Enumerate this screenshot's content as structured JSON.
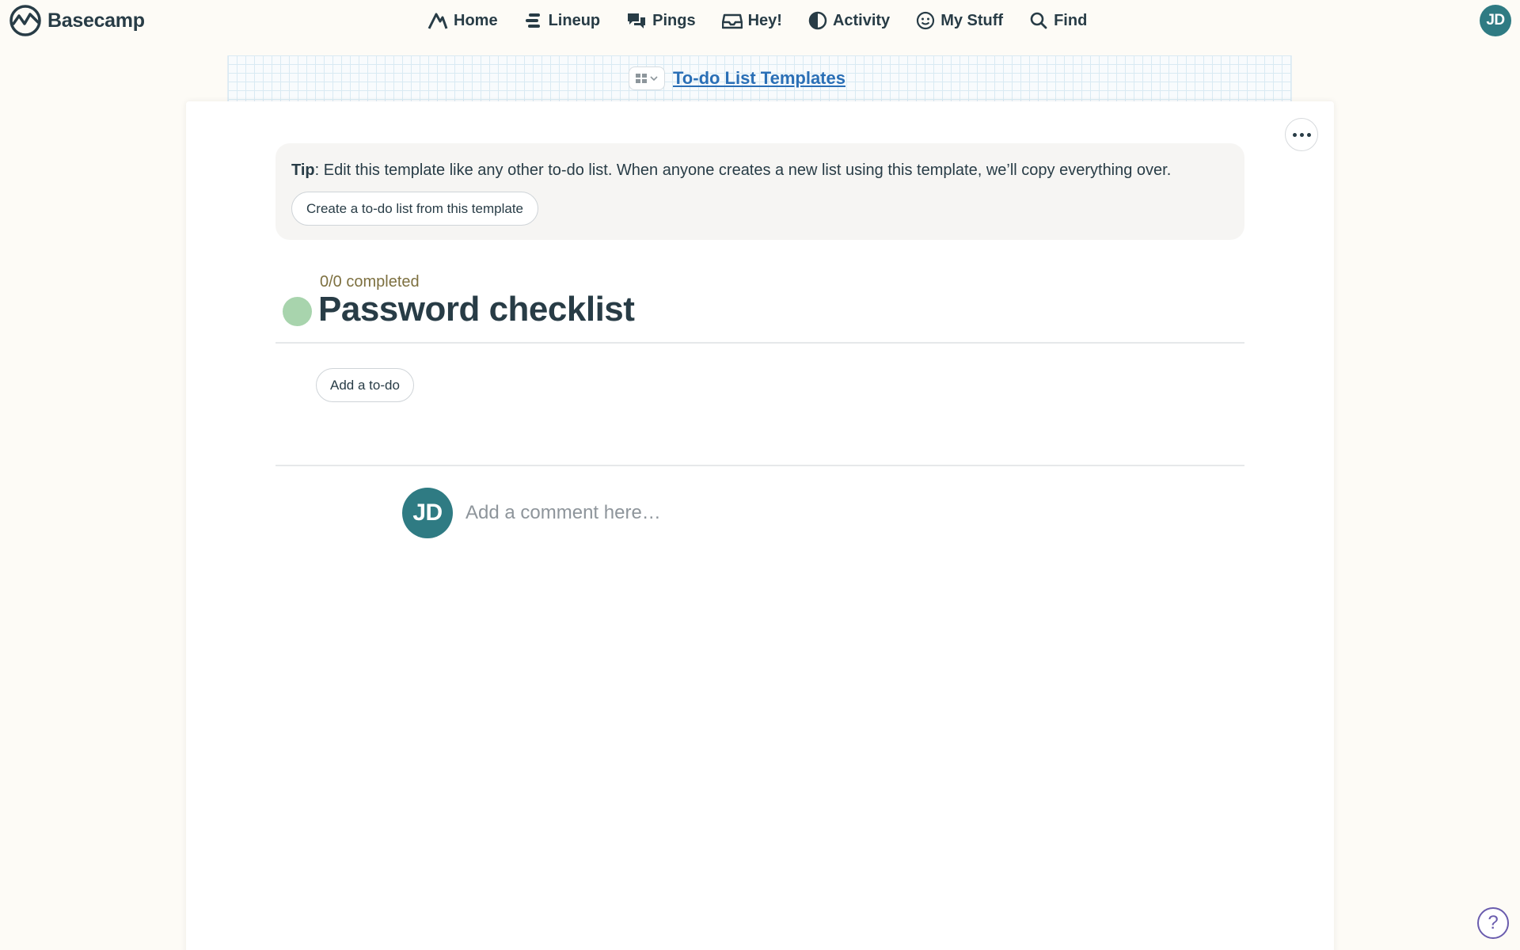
{
  "app": {
    "name": "Basecamp"
  },
  "nav": {
    "items": [
      {
        "label": "Home",
        "icon": "home-icon"
      },
      {
        "label": "Lineup",
        "icon": "lineup-icon"
      },
      {
        "label": "Pings",
        "icon": "pings-icon"
      },
      {
        "label": "Hey!",
        "icon": "inbox-icon"
      },
      {
        "label": "Activity",
        "icon": "activity-icon"
      },
      {
        "label": "My Stuff",
        "icon": "smiley-icon"
      },
      {
        "label": "Find",
        "icon": "search-icon"
      }
    ]
  },
  "user": {
    "initials": "JD",
    "avatar_color": "#2f7b83"
  },
  "breadcrumb": {
    "link": "To-do List Templates"
  },
  "tip": {
    "label": "Tip",
    "text": ": Edit this template like any other to-do list. When anyone creates a new list using this template, we’ll copy everything over.",
    "button": "Create a to-do list from this template"
  },
  "list": {
    "progress": "0/0 completed",
    "title": "Password checklist",
    "dot_color": "#a8d4ad",
    "add_button": "Add a to-do"
  },
  "comment": {
    "placeholder": "Add a comment here…"
  },
  "help": {
    "label": "?"
  },
  "colors": {
    "link": "#2a6fb6",
    "text": "#283c46",
    "background": "#fdfbf6",
    "accent_help": "#6a5cae"
  }
}
